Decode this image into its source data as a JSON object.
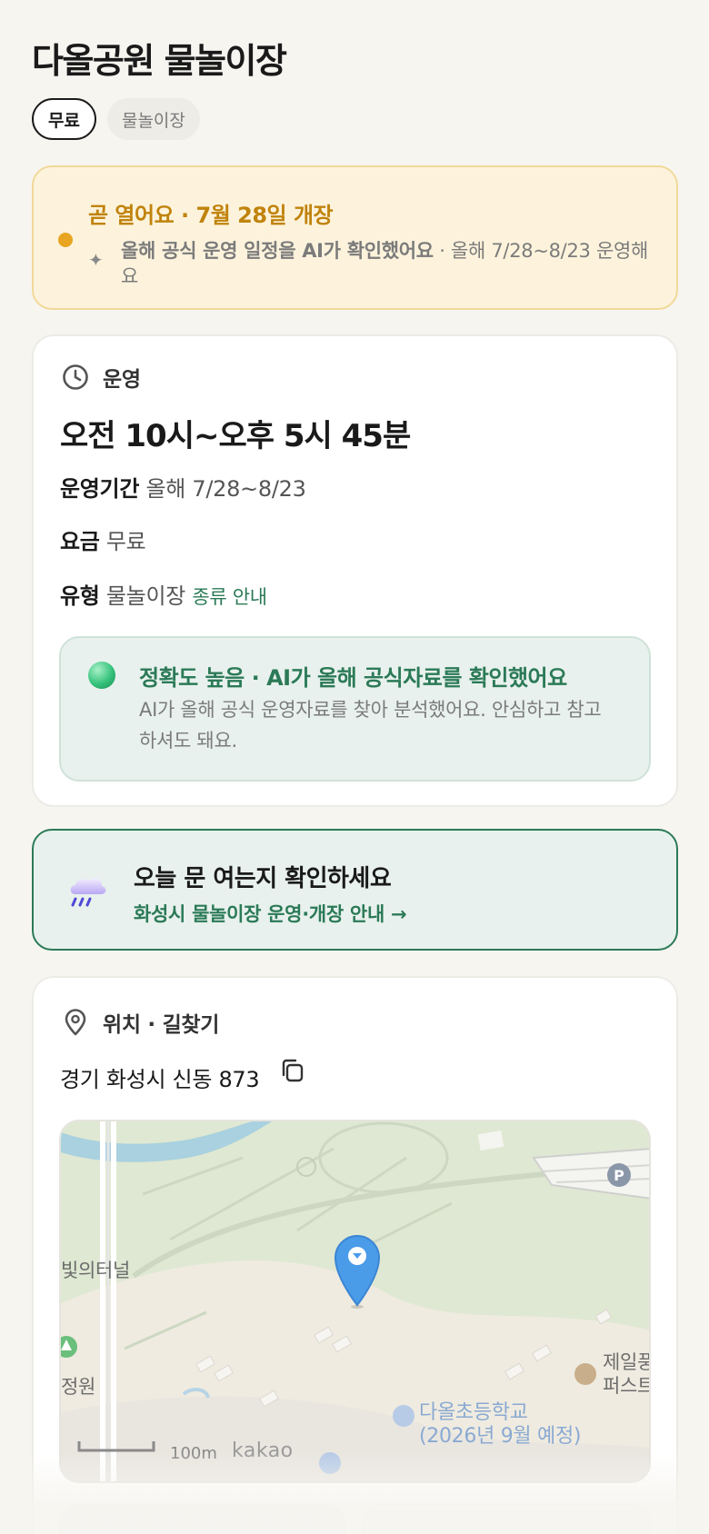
{
  "page": {
    "title": "다올공원 물놀이장"
  },
  "chips": [
    {
      "label": "무료"
    },
    {
      "label": "물놀이장"
    }
  ],
  "notice": {
    "headline": "곧 열어요 · 7월 28일 개장",
    "sub_bold": "올해 공식 운영 일정을 AI가 확인했어요",
    "sub_rest": " · 올해 7/28~8/23 운영해요",
    "colors": {
      "accent": "#c0830c",
      "dot": "#e7a521"
    }
  },
  "operation": {
    "section_label": "운영",
    "hours": "오전 10시~오후 5시 45분",
    "period_key": "운영기간",
    "period_value": "올해 7/28~8/23",
    "fee_key": "요금",
    "fee_value": "무료",
    "type_key": "유형",
    "type_value": "물놀이장",
    "type_link": "종류 안내",
    "accuracy": {
      "title": "정확도 높음 · AI가 올해 공식자료를 확인했어요",
      "desc": "AI가 올해 공식 운영자료를 찾아 분석했어요. 안심하고 참고하셔도 돼요."
    }
  },
  "weather": {
    "title": "오늘 문 여는지 확인하세요",
    "link": "화성시 물놀이장 운영·개장 안내 →"
  },
  "location": {
    "section_label": "위치 · 길찾기",
    "address": "경기 화성시 신동 873",
    "map": {
      "labels": {
        "tunnel": "빛의터널",
        "garden": "정원",
        "school_line1": "다올초등학교",
        "school_line2": "(2026년 9월 예정)",
        "right_line1": "제일풍",
        "right_line2": "퍼스트"
      },
      "scale": "100m",
      "brand": "kakao",
      "parking": "P"
    }
  },
  "colors": {
    "brand_green": "#2b7a57",
    "background": "#f7f5f0"
  }
}
